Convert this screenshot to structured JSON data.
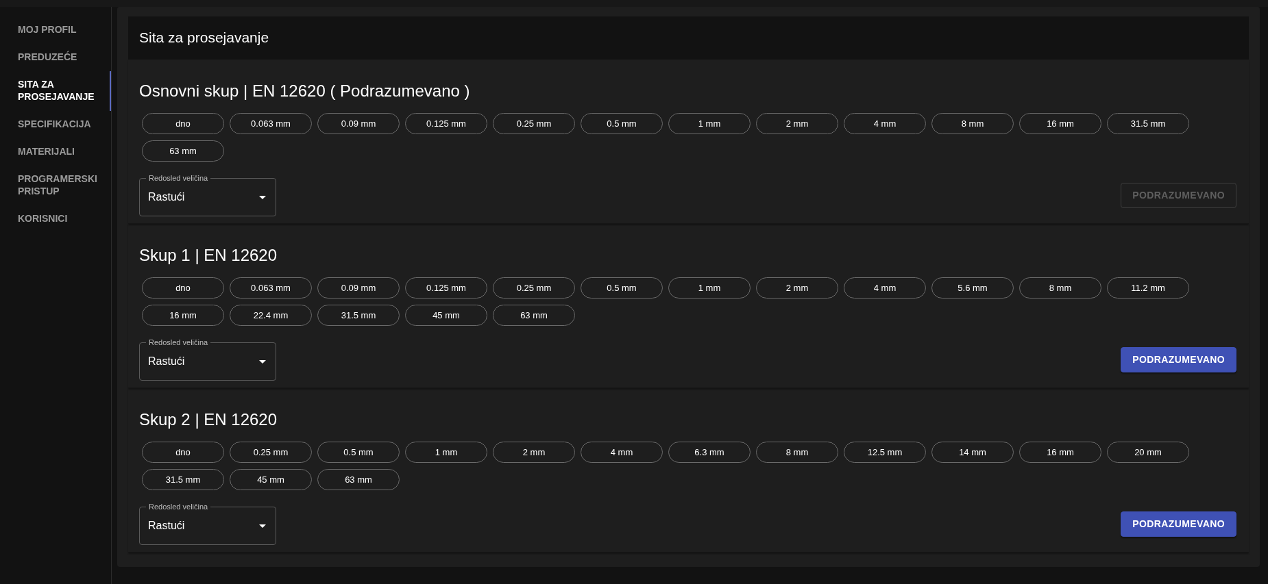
{
  "sidebar": {
    "items": [
      {
        "label": "MOJ PROFIL",
        "selected": false
      },
      {
        "label": "PREDUZEĆE",
        "selected": false
      },
      {
        "label": "SITA ZA PROSEJAVANJE",
        "selected": true
      },
      {
        "label": "SPECIFIKACIJA",
        "selected": false
      },
      {
        "label": "MATERIJALI",
        "selected": false
      },
      {
        "label": "PROGRAMERSKI PRISTUP",
        "selected": false
      },
      {
        "label": "KORISNICI",
        "selected": false
      }
    ]
  },
  "page": {
    "title": "Sita za prosejavanje"
  },
  "sets": [
    {
      "title": "Osnovni skup | EN 12620 ( Podrazumevano )",
      "sieves": [
        "dno",
        "0.063 mm",
        "0.09 mm",
        "0.125 mm",
        "0.25 mm",
        "0.5 mm",
        "1 mm",
        "2 mm",
        "4 mm",
        "8 mm",
        "16 mm",
        "31.5 mm",
        "63 mm"
      ],
      "order": {
        "label": "Redosled veličina",
        "value": "Rastući"
      },
      "button": {
        "label": "PODRAZUMEVANO",
        "disabled": true
      }
    },
    {
      "title": "Skup 1 | EN 12620",
      "sieves": [
        "dno",
        "0.063 mm",
        "0.09 mm",
        "0.125 mm",
        "0.25 mm",
        "0.5 mm",
        "1 mm",
        "2 mm",
        "4 mm",
        "5.6 mm",
        "8 mm",
        "11.2 mm",
        "16 mm",
        "22.4 mm",
        "31.5 mm",
        "45 mm",
        "63 mm"
      ],
      "order": {
        "label": "Redosled veličina",
        "value": "Rastući"
      },
      "button": {
        "label": "PODRAZUMEVANO",
        "disabled": false
      }
    },
    {
      "title": "Skup 2 | EN 12620",
      "sieves": [
        "dno",
        "0.25 mm",
        "0.5 mm",
        "1 mm",
        "2 mm",
        "4 mm",
        "6.3 mm",
        "8 mm",
        "12.5 mm",
        "14 mm",
        "16 mm",
        "20 mm",
        "31.5 mm",
        "45 mm",
        "63 mm"
      ],
      "order": {
        "label": "Redosled veličina",
        "value": "Rastući"
      },
      "button": {
        "label": "PODRAZUMEVANO",
        "disabled": false
      }
    }
  ]
}
